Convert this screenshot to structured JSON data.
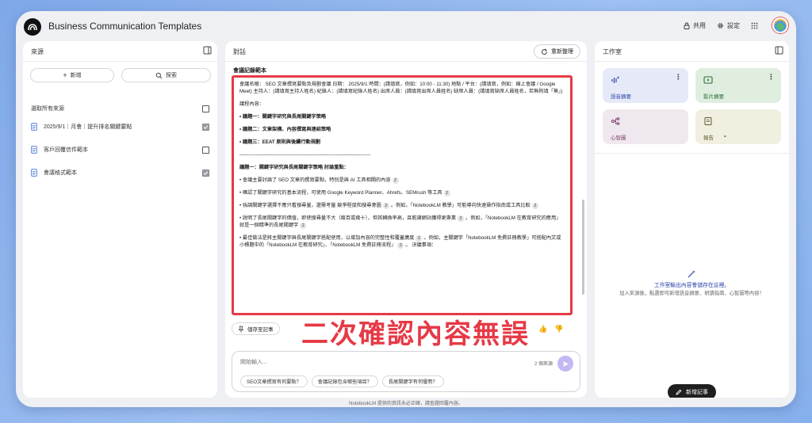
{
  "app": {
    "title": "Business Communication Templates"
  },
  "header": {
    "share_label": "共用",
    "settings_label": "設定"
  },
  "sources": {
    "title": "來源",
    "add_label": "新增",
    "search_label": "探索",
    "select_all_label": "選取所有來源",
    "items": [
      {
        "label": "2025/9/1｜月會｜提升排名關鍵要點",
        "checked": true
      },
      {
        "label": "客戶回覆信件範本",
        "checked": false
      },
      {
        "label": "會議格式範本",
        "checked": true
      }
    ]
  },
  "chat": {
    "title": "對話",
    "regen_label": "重新整理",
    "note_title": "會議記錄範本",
    "save_label": "儲存至記事",
    "overlay_text": "二次確認內容無誤",
    "input_placeholder": "開始輸入...",
    "source_count": "2 個來源",
    "chips": [
      "SEO文章撰寫有何要點？",
      "會議記錄包含哪些項目？",
      "長尾關鍵字有何優勢？"
    ],
    "content": {
      "p1": "會議名稱： SEO 文章撰寫要點及規劃會議 日期： 2025/9/1 時間：(請填寫，例如：10:00 - 11:30) 地點 / 平台：(請填寫，例如：線上會議 / Google Meet) 主持人：(請填寫主持人姓名) 紀錄人：(請填寫紀錄人姓名) 出席人員：(請填寫出席人員姓名) 缺席人員：(請填寫缺席人員姓名，若無則填「無」)",
      "p2": "議程內容：",
      "a1": "• 議題一：關鍵字研究與長尾關鍵字策略",
      "a2": "• 議題二：文章架構、內容撰寫與連結策略",
      "a3": "• 議題三：EEAT 原則與後續行動規劃",
      "divider": "--------------------------------------------------------------------------------",
      "s1": "議題一：關鍵字研究與長尾關鍵字策略 討論重點：",
      "b1a": "• 會議主要討論了 SEO 文章的撰寫要點，特別是與 AI 工具相關的內容",
      "b2a": "• 確認了關鍵字研究的基本流程，可使用 Google Keyword Planner、Ahrefs、SEMrush 等工具",
      "b3a": "• 強調關鍵字選擇不應只看搜尋量，還需考量 競爭程度和搜尋意圖",
      "b3b": "。例如，「NotebookLM 教學」可能導向快速操作指南或工具比較",
      "b4a": "• 說明了長尾關鍵字的價值，即使搜尋量不大（幾百或幾十），但其轉換率高，且能讓網站獲得更專業",
      "b4b": "。例如，「NotebookLM 在教育研究的應用」就是一個精準的長尾關鍵字",
      "b5a": "• 最佳做法是將主關鍵字與長尾關鍵字搭配使用，以增加內容的完整性和覆蓋廣度",
      "b5b": "。例如，主關鍵字「NotebookLM 免費註冊教學」可搭配內文或小標題中的「NotebookLM 在教育研究」、「NotebookLM 免費註冊流程」",
      "b5c": "。 決議事項：",
      "cite": "2"
    }
  },
  "studio": {
    "title": "工作室",
    "cards": [
      {
        "label": "語音摘要",
        "icon": "waveform-icon"
      },
      {
        "label": "影片摘要",
        "icon": "video-icon"
      },
      {
        "label": "心智圖",
        "icon": "mindmap-icon"
      },
      {
        "label": "報告",
        "icon": "report-icon"
      }
    ],
    "empty_title": "工作室輸出內容會儲存在這裡。",
    "empty_sub": "加入來源後，點選即可新增語音摘要、研讀指南、心智圖等內容！",
    "add_note_label": "新增記事"
  },
  "footer": {
    "disclaimer": "NotebookLM 提供的資訊未必正確，請查證回覆內容。"
  }
}
